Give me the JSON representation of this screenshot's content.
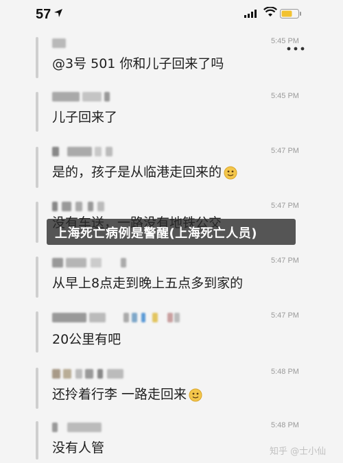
{
  "status_bar": {
    "time": "57",
    "wifi": "wifi-icon",
    "battery": "battery-icon",
    "battery_color": "#f2c230"
  },
  "messages": [
    {
      "time": "5:45 PM",
      "text": "@3号 501 你和儿子回来了吗",
      "emoji": false
    },
    {
      "time": "5:45 PM",
      "text": "儿子回来了",
      "emoji": false
    },
    {
      "time": "5:47 PM",
      "text": "是的，孩子是从临港走回来的",
      "emoji": true
    },
    {
      "time": "5:47 PM",
      "text": "没有车送，一路没有地铁公交",
      "emoji": false
    },
    {
      "time": "5:47 PM",
      "text": "从早上8点走到晚上五点多到家的",
      "emoji": false
    },
    {
      "time": "5:47 PM",
      "text": "20公里有吧",
      "emoji": false
    },
    {
      "time": "5:48 PM",
      "text": "还拎着行李 一路走回来",
      "emoji": true
    },
    {
      "time": "5:48 PM",
      "text": "没有人管",
      "emoji": false
    }
  ],
  "overlay_banner": "上海死亡病例是警醒(上海死亡人员)",
  "watermark": "知乎 @士小仙"
}
